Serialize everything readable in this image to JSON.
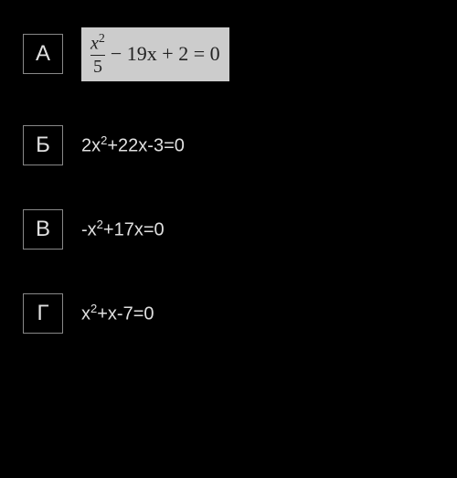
{
  "options": [
    {
      "label": "А",
      "highlighted": true,
      "equation": {
        "type": "fraction",
        "numerator_var": "x",
        "numerator_exp": "2",
        "denominator": "5",
        "rest": " − 19x + 2 = 0"
      }
    },
    {
      "label": "Б",
      "highlighted": false,
      "equation": {
        "type": "plain",
        "parts": [
          {
            "text": "2x",
            "sup": "2"
          },
          {
            "text": "+22x-3=0"
          }
        ]
      }
    },
    {
      "label": "В",
      "highlighted": false,
      "equation": {
        "type": "plain",
        "parts": [
          {
            "text": "-x",
            "sup": "2"
          },
          {
            "text": "+17x=0"
          }
        ]
      }
    },
    {
      "label": "Г",
      "highlighted": false,
      "equation": {
        "type": "plain",
        "parts": [
          {
            "text": "x",
            "sup": "2"
          },
          {
            "text": "+x-7=0"
          }
        ]
      }
    }
  ]
}
